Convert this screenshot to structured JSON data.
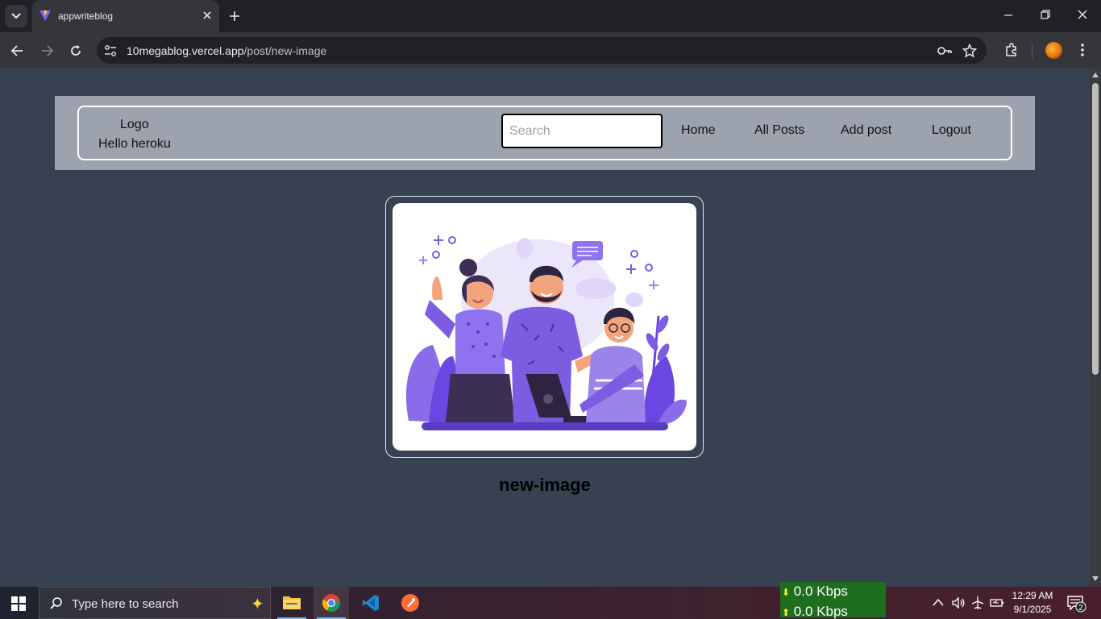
{
  "browser": {
    "tab_title": "appwriteblog",
    "url_host": "10megablog.vercel.app",
    "url_path": "/post/new-image"
  },
  "header": {
    "logo": "Logo",
    "greeting": "Hello heroku",
    "search_placeholder": "Search",
    "nav": [
      "Home",
      "All Posts",
      "Add post",
      "Logout"
    ]
  },
  "post": {
    "title": "new-image",
    "image_alt": "Illustration of three people gathered around a laptop"
  },
  "taskbar": {
    "search_placeholder": "Type here to search",
    "net_down": "0.0 Kbps",
    "net_up": "0.0 Kbps",
    "time": "12:29 AM",
    "date": "9/1/2025",
    "notifications": "2"
  },
  "colors": {
    "page_bg": "#374151",
    "header_bg": "#9ca3af",
    "accent_purple": "#6b46e0"
  }
}
